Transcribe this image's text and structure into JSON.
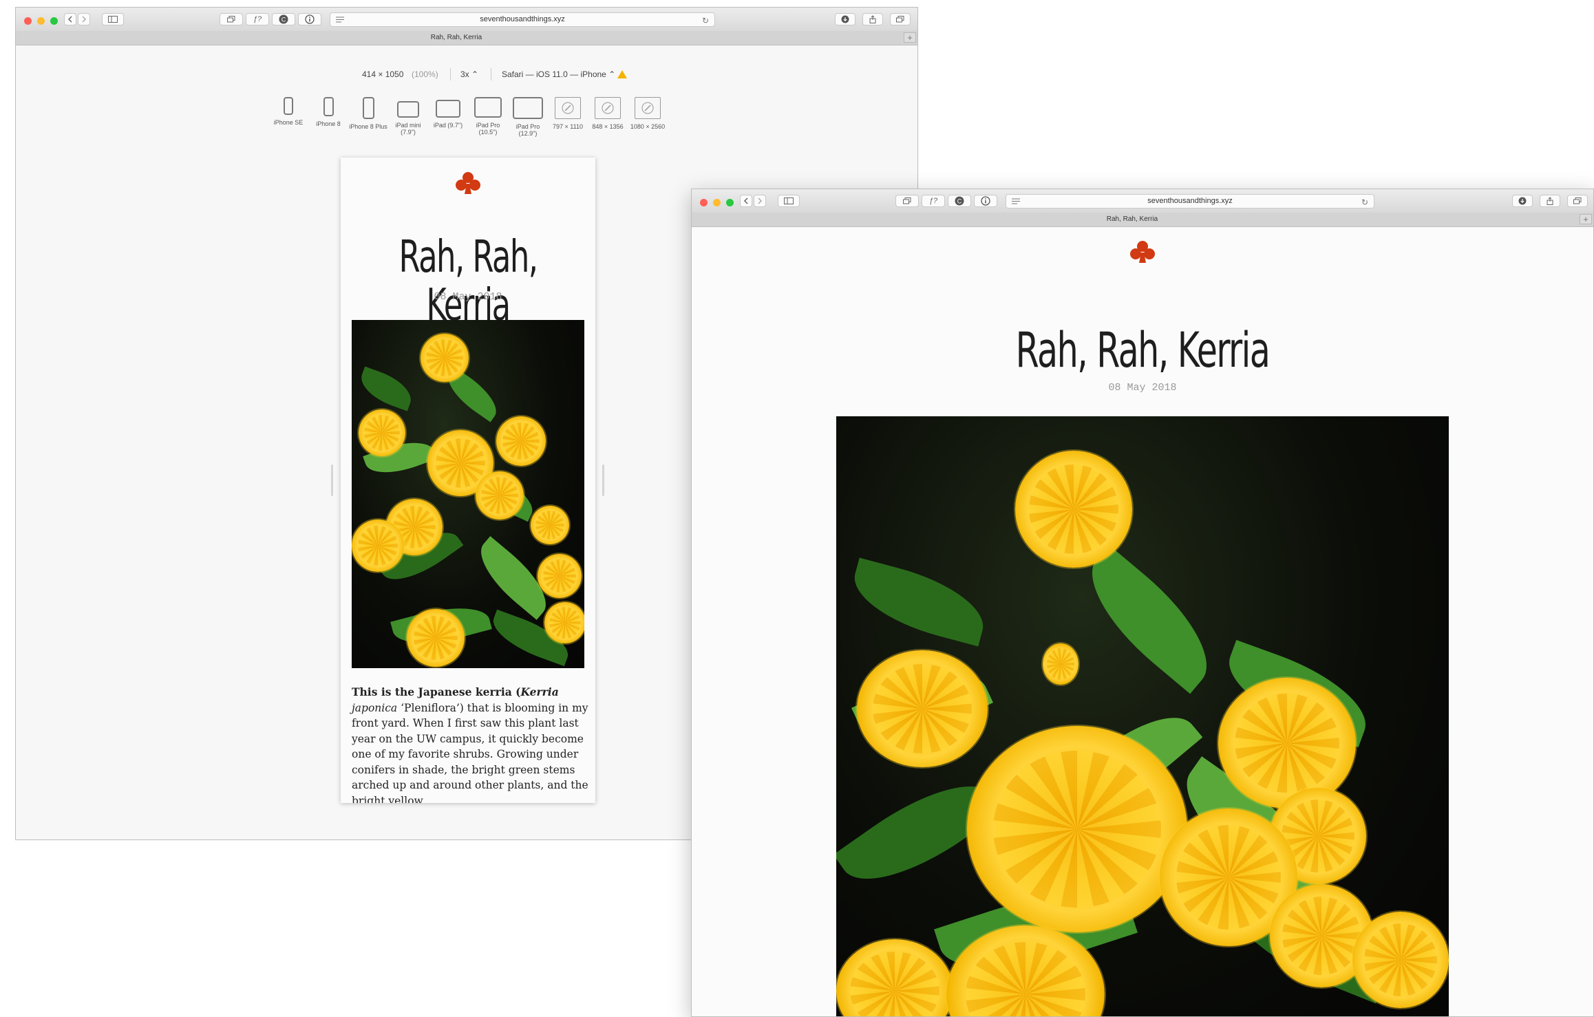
{
  "browser": {
    "url": "seventhousandthings.xyz",
    "tab_title": "Rah, Rah, Kerria",
    "new_tab": "+",
    "reload": "↻"
  },
  "responsive_mode": {
    "dimensions": "414 × 1050",
    "zoom": "(100%)",
    "scale": "3x ⌃",
    "user_agent": "Safari — iOS 11.0 — iPhone ⌃",
    "devices": [
      {
        "label": "iPhone SE"
      },
      {
        "label": "iPhone 8"
      },
      {
        "label": "iPhone 8 Plus"
      },
      {
        "label": "iPad mini (7.9\")"
      },
      {
        "label": "iPad (9.7\")"
      },
      {
        "label": "iPad Pro (10.5\")"
      },
      {
        "label": "iPad Pro (12.9\")"
      },
      {
        "label": "797 × 1110"
      },
      {
        "label": "848 × 1356"
      },
      {
        "label": "1080 × 2560"
      }
    ]
  },
  "post": {
    "title": "Rah, Rah, Kerria",
    "date": "08 May 2018",
    "intro_bold": "This is the Japanese kerria (",
    "intro_bold_italic": "Kerria",
    "italic_word": "japonica",
    "body_rest": " ‘Pleniflora’) that is blooming in my front yard. When I first saw this plant last year on the UW campus, it quickly become one of my favorite shrubs. Growing under conifers in shade, the bright green stems arched up and around other plants, and the bright yellow"
  },
  "colors": {
    "club": "#d13a12",
    "flower": "#ffc61a",
    "leaf": "#3f8f2a"
  }
}
